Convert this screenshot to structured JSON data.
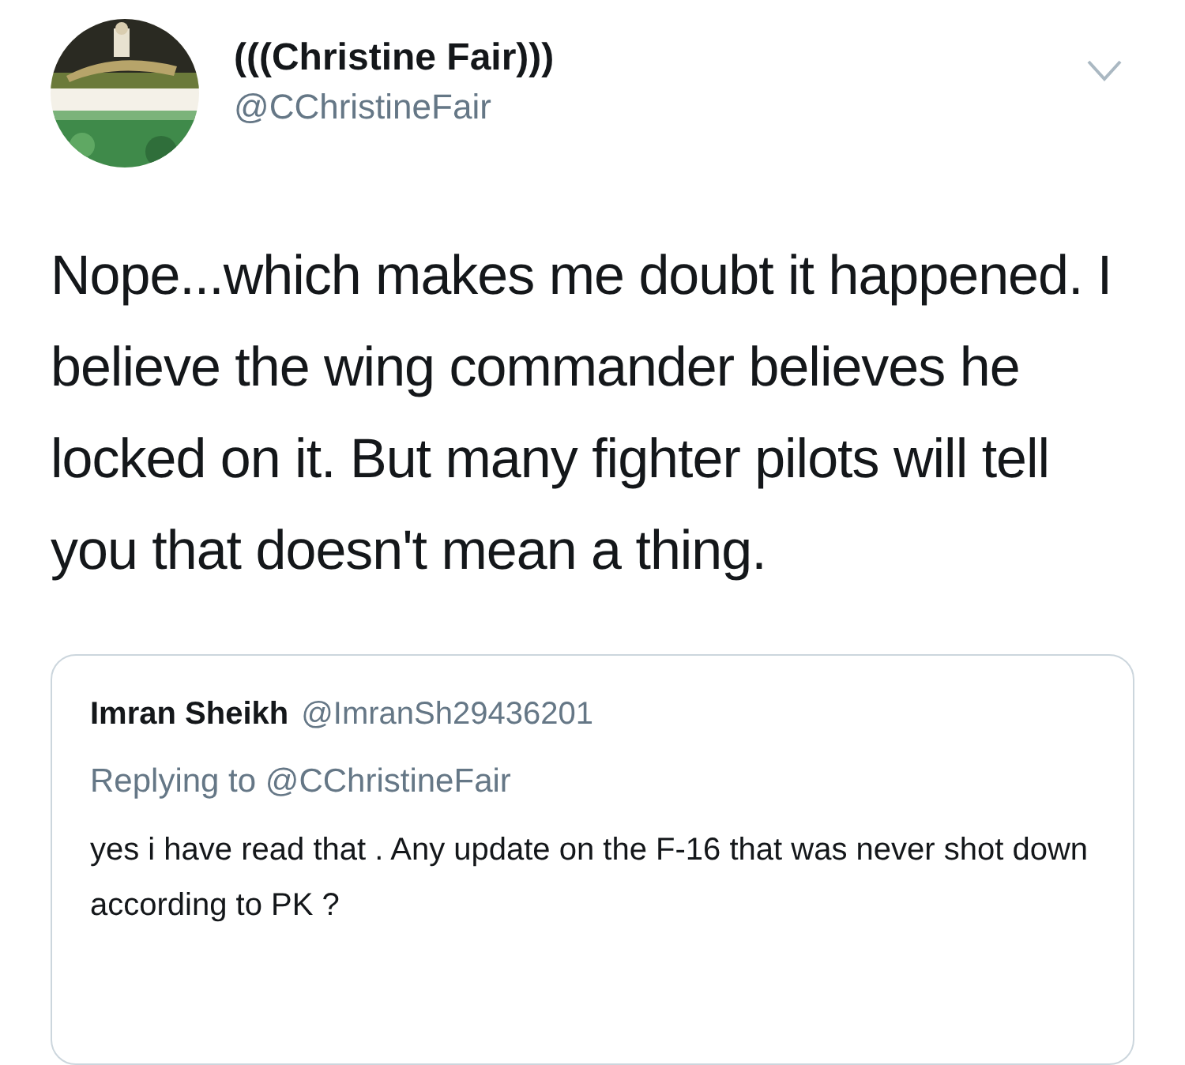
{
  "author": {
    "name": "(((Christine Fair)))",
    "handle": "@CChristineFair"
  },
  "tweet_text": "Nope...which makes me doubt it happened. I believe the wing commander believes he locked on it. But many fighter pilots will tell you that doesn't mean a thing.",
  "quoted_tweet": {
    "name": "Imran Sheikh",
    "handle": "@ImranSh29436201",
    "replying_to": "Replying to @CChristineFair",
    "text": "yes i have read that . Any update on the F-16 that was never shot down according to PK ?"
  }
}
